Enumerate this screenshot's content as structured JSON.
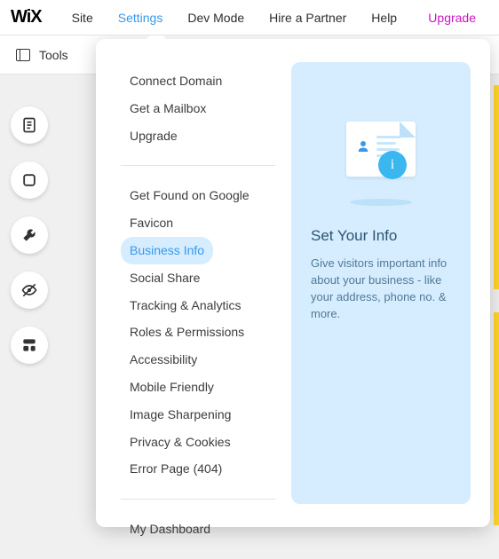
{
  "logo_text": "WiX",
  "menubar": {
    "items": [
      {
        "label": "Site"
      },
      {
        "label": "Settings",
        "active": true
      },
      {
        "label": "Dev Mode"
      },
      {
        "label": "Hire a Partner"
      },
      {
        "label": "Help"
      }
    ],
    "upgrade_label": "Upgrade"
  },
  "toolsbar": {
    "tools_label": "Tools"
  },
  "rail": {
    "buttons": [
      "pages-icon",
      "section-icon",
      "tools-icon",
      "hide-icon",
      "layout-icon"
    ]
  },
  "settings_menu": {
    "groups": [
      {
        "items": [
          {
            "label": "Connect Domain"
          },
          {
            "label": "Get a Mailbox"
          },
          {
            "label": "Upgrade"
          }
        ]
      },
      {
        "items": [
          {
            "label": "Get Found on Google"
          },
          {
            "label": "Favicon"
          },
          {
            "label": "Business Info",
            "selected": true
          },
          {
            "label": "Social Share"
          },
          {
            "label": "Tracking & Analytics"
          },
          {
            "label": "Roles & Permissions"
          },
          {
            "label": "Accessibility"
          },
          {
            "label": "Mobile Friendly"
          },
          {
            "label": "Image Sharpening"
          },
          {
            "label": "Privacy & Cookies"
          },
          {
            "label": "Error Page (404)"
          }
        ]
      },
      {
        "items": [
          {
            "label": "My Dashboard"
          }
        ]
      }
    ]
  },
  "preview": {
    "title": "Set Your Info",
    "description": "Give visitors important info about your business - like your address, phone no. & more.",
    "badge_char": "i"
  }
}
